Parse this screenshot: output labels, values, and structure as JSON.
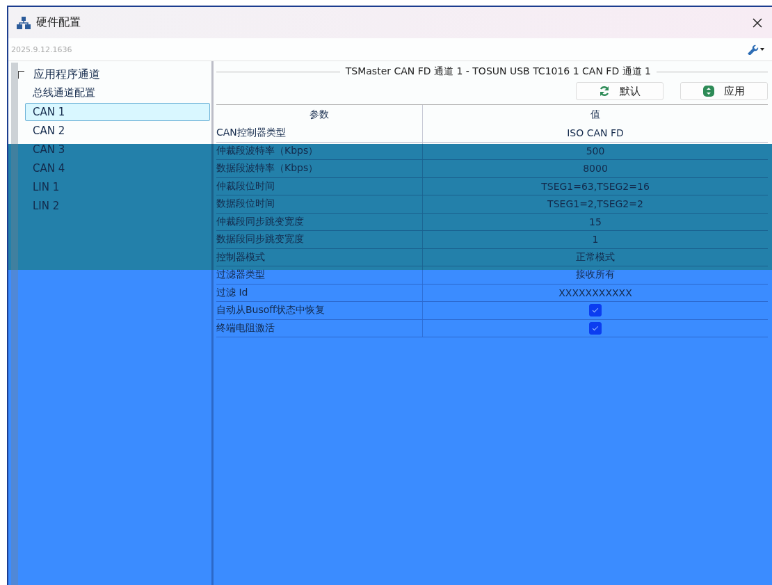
{
  "window": {
    "title": "硬件配置",
    "version": "2025.9.12.1636"
  },
  "tree": [
    {
      "label": "应用程序通道",
      "expanded": true,
      "selected": false,
      "children": [
        {
          "label": "总线通道配置",
          "selected": false
        },
        {
          "label": "CAN 1",
          "selected": true
        },
        {
          "label": "CAN 2",
          "selected": false
        },
        {
          "label": "CAN 3",
          "selected": false
        },
        {
          "label": "CAN 4",
          "selected": false
        },
        {
          "label": "LIN 1",
          "selected": false
        },
        {
          "label": "LIN 2",
          "selected": false
        }
      ]
    }
  ],
  "group_title": "TSMaster CAN FD 通道 1 - TOSUN USB TC1016 1 CAN FD 通道 1",
  "buttons": [
    {
      "label": "默认",
      "kind": "reset"
    },
    {
      "label": "应用",
      "kind": "apply"
    }
  ],
  "table": {
    "columns": [
      "参数",
      "值"
    ],
    "rows": [
      {
        "param": "CAN控制器类型",
        "kind": "text",
        "value": "ISO CAN FD"
      },
      {
        "param": "仲裁段波特率（Kbps）",
        "kind": "text",
        "value": "500"
      },
      {
        "param": "数据段波特率（Kbps）",
        "kind": "text",
        "value": "8000"
      },
      {
        "param": "仲裁段位时间",
        "kind": "text",
        "value": "TSEG1=63,TSEG2=16"
      },
      {
        "param": "数据段位时间",
        "kind": "text",
        "value": "TSEG1=2,TSEG2=2"
      },
      {
        "param": "仲裁段同步跳变宽度",
        "kind": "text",
        "value": "15"
      },
      {
        "param": "数据段同步跳变宽度",
        "kind": "text",
        "value": "1"
      },
      {
        "param": "控制器模式",
        "kind": "text",
        "value": "正常模式"
      },
      {
        "param": "过滤器类型",
        "kind": "text",
        "value": "接收所有"
      },
      {
        "param": "过滤 Id",
        "kind": "text",
        "value": "XXXXXXXXXXX"
      },
      {
        "param": "自动从Busoff状态中恢复",
        "kind": "checkbox",
        "checked": true
      },
      {
        "param": "终端电阻激活",
        "kind": "checkbox",
        "checked": true
      }
    ]
  }
}
